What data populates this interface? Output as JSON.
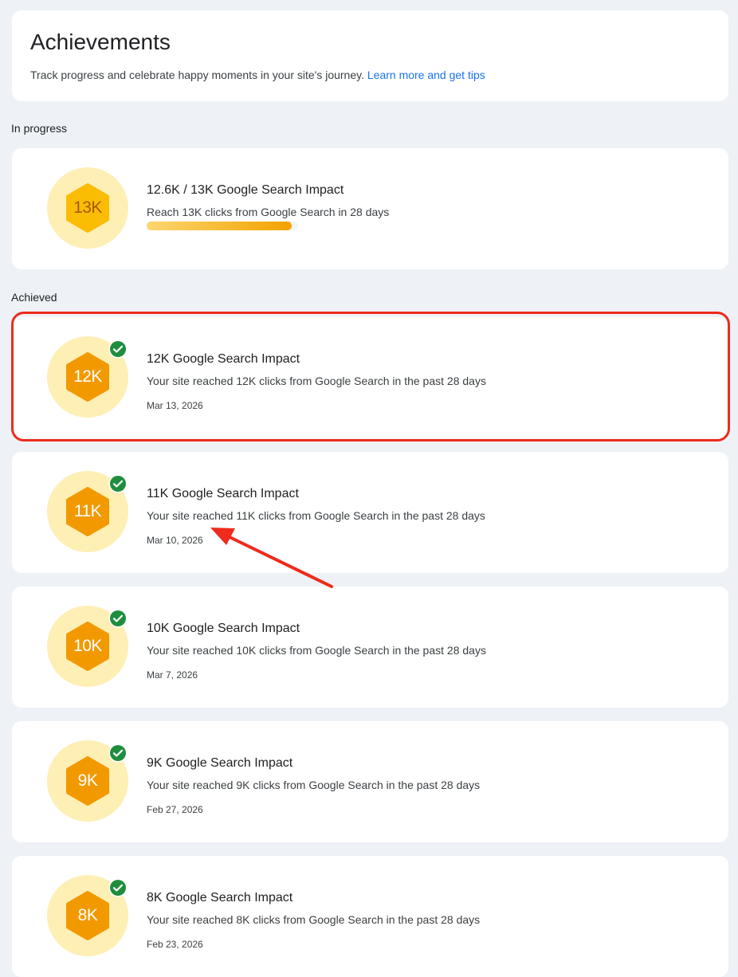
{
  "header": {
    "title": "Achievements",
    "description": "Track progress and celebrate happy moments in your site's journey.",
    "learn_link": "Learn more and get tips"
  },
  "sections": {
    "in_progress_label": "In progress",
    "achieved_label": "Achieved"
  },
  "in_progress": {
    "badge": "13K",
    "title": "12.6K / 13K Google Search Impact",
    "description": "Reach 13K clicks from Google Search in 28 days",
    "progress_fraction": 0.96
  },
  "achieved": [
    {
      "badge": "12K",
      "title": "12K Google Search Impact",
      "description": "Your site reached 12K clicks from Google Search in the past 28 days",
      "date": "Mar 13, 2026"
    },
    {
      "badge": "11K",
      "title": "11K Google Search Impact",
      "description": "Your site reached 11K clicks from Google Search in the past 28 days",
      "date": "Mar 10, 2026"
    },
    {
      "badge": "10K",
      "title": "10K Google Search Impact",
      "description": "Your site reached 10K clicks from Google Search in the past 28 days",
      "date": "Mar 7, 2026"
    },
    {
      "badge": "9K",
      "title": "9K Google Search Impact",
      "description": "Your site reached 9K clicks from Google Search in the past 28 days",
      "date": "Feb 27, 2026"
    },
    {
      "badge": "8K",
      "title": "8K Google Search Impact",
      "description": "Your site reached 8K clicks from Google Search in the past 28 days",
      "date": "Feb 23, 2026"
    }
  ],
  "colors": {
    "badge_circle": "#feefb5",
    "badge_hex_achieved": "#f29900",
    "badge_hex_pending": "#fbbc04",
    "check": "#1e8e3e",
    "link": "#1a73e8",
    "annotation": "#ee2b1c"
  },
  "icons": {
    "badge": "hexagon-icon",
    "achieved": "check-circle-icon",
    "annotation": "arrow-icon"
  }
}
